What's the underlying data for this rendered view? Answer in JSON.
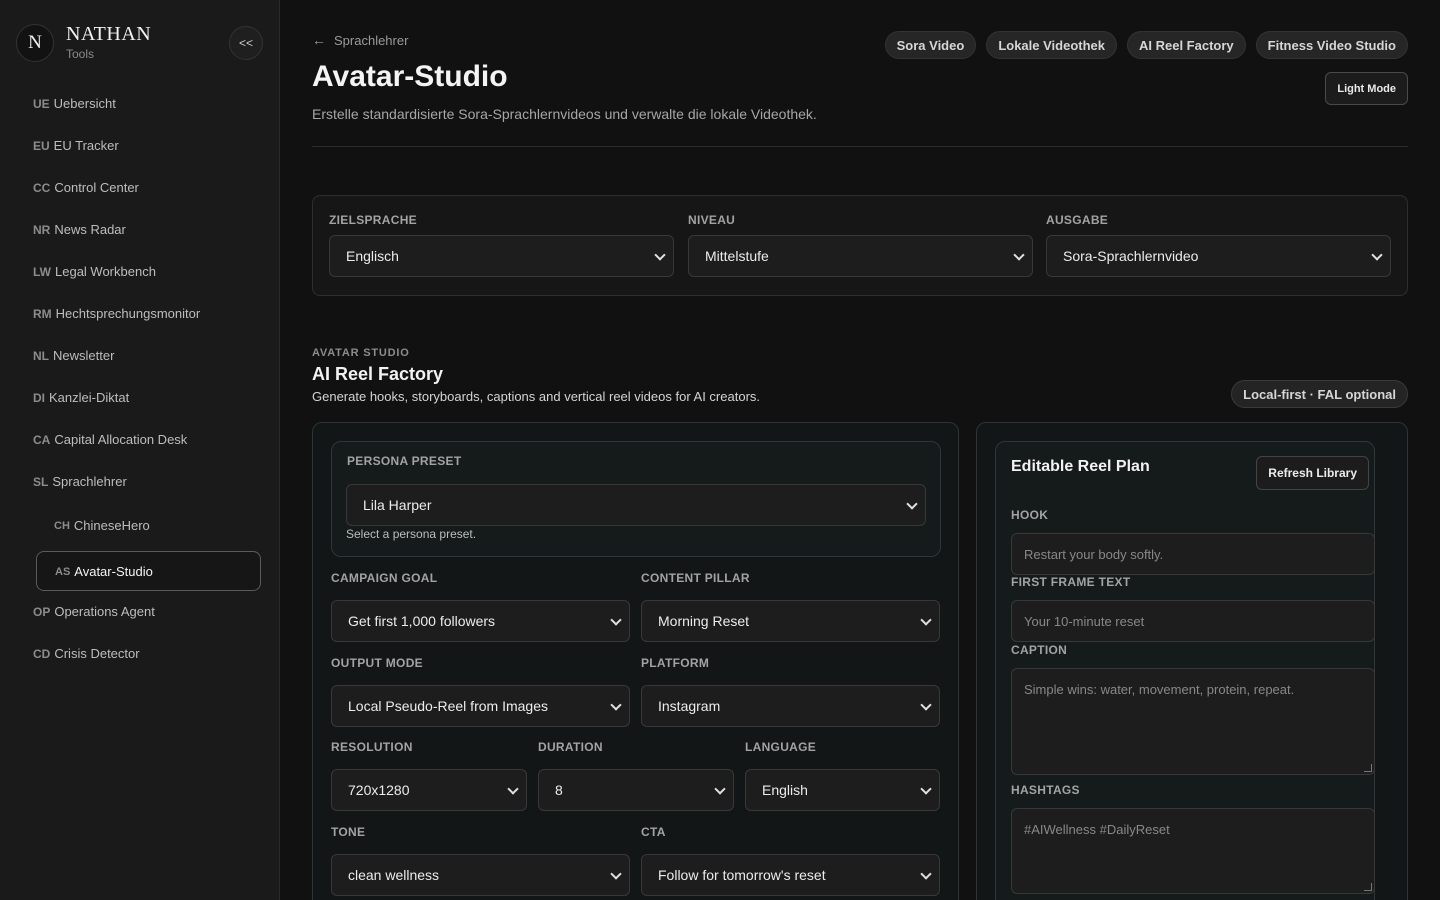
{
  "brand": {
    "logo_letter": "N",
    "name": "NATHAN",
    "subtitle": "Tools",
    "collapse_label": "<<"
  },
  "nav": {
    "items": [
      {
        "abbr": "UE",
        "label": "Uebersicht"
      },
      {
        "abbr": "EU",
        "label": "EU Tracker"
      },
      {
        "abbr": "CC",
        "label": "Control Center"
      },
      {
        "abbr": "NR",
        "label": "News Radar"
      },
      {
        "abbr": "LW",
        "label": "Legal Workbench"
      },
      {
        "abbr": "RM",
        "label": "Hechtsprechungsmonitor"
      },
      {
        "abbr": "NL",
        "label": "Newsletter"
      },
      {
        "abbr": "DI",
        "label": "Kanzlei-Diktat"
      },
      {
        "abbr": "CA",
        "label": "Capital Allocation Desk"
      },
      {
        "abbr": "SL",
        "label": "Sprachlehrer"
      },
      {
        "abbr": "CH",
        "label": "ChineseHero"
      },
      {
        "abbr": "AS",
        "label": "Avatar-Studio"
      },
      {
        "abbr": "OP",
        "label": "Operations Agent"
      },
      {
        "abbr": "CD",
        "label": "Crisis Detector"
      }
    ]
  },
  "header": {
    "back_arrow": "←",
    "back_label": "Sprachlehrer",
    "pills": [
      "Sora Video",
      "Lokale Videothek",
      "AI Reel Factory",
      "Fitness Video Studio"
    ],
    "title": "Avatar-Studio",
    "description": "Erstelle standardisierte Sora-Sprachlernvideos und verwalte die lokale Videothek.",
    "theme_button": "Light Mode"
  },
  "filters": [
    {
      "label": "ZIELSPRACHE",
      "value": "Englisch"
    },
    {
      "label": "NIVEAU",
      "value": "Mittelstufe"
    },
    {
      "label": "AUSGABE",
      "value": "Sora-Sprachlernvideo"
    }
  ],
  "section": {
    "kicker": "AVATAR STUDIO",
    "title": "AI Reel Factory",
    "description": "Generate hooks, storyboards, captions and vertical reel videos for AI creators.",
    "badge": "Local-first · FAL optional"
  },
  "form": {
    "persona": {
      "label": "PERSONA PRESET",
      "value": "Lila Harper",
      "hint": "Select a persona preset."
    },
    "campaign_goal": {
      "label": "CAMPAIGN GOAL",
      "value": "Get first 1,000 followers"
    },
    "content_pillar": {
      "label": "CONTENT PILLAR",
      "value": "Morning Reset"
    },
    "output_mode": {
      "label": "OUTPUT MODE",
      "value": "Local Pseudo-Reel from Images"
    },
    "platform": {
      "label": "PLATFORM",
      "value": "Instagram"
    },
    "resolution": {
      "label": "RESOLUTION",
      "value": "720x1280"
    },
    "duration": {
      "label": "DURATION",
      "value": "8"
    },
    "language": {
      "label": "LANGUAGE",
      "value": "English"
    },
    "tone": {
      "label": "TONE",
      "value": "clean wellness"
    },
    "cta": {
      "label": "CTA",
      "value": "Follow for tomorrow's reset"
    }
  },
  "plan": {
    "title": "Editable Reel Plan",
    "refresh_button": "Refresh Library",
    "hook": {
      "label": "HOOK",
      "placeholder": "Restart your body softly."
    },
    "first_frame": {
      "label": "FIRST FRAME TEXT",
      "placeholder": "Your 10-minute reset"
    },
    "caption": {
      "label": "CAPTION",
      "placeholder": "Simple wins: water, movement, protein, repeat."
    },
    "hashtags": {
      "label": "HASHTAGS",
      "placeholder": "#AIWellness #DailyReset"
    }
  }
}
